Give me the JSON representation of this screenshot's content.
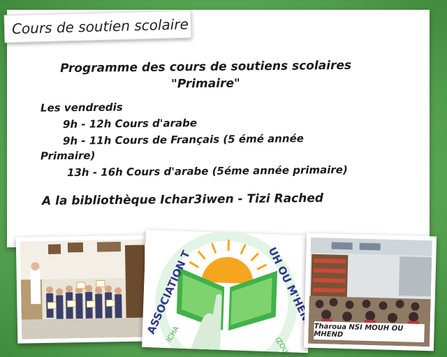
{
  "header": {
    "tag": "Cours de soutien scolaire"
  },
  "program": {
    "title_line1": "Programme des cours de soutiens scolaires",
    "title_line2": "\"Primaire\"",
    "schedule": [
      "Les vendredis",
      "9h - 12h  Cours d'arabe",
      "9h - 11h Cours de Français (5 émé année",
      "Primaire)",
      "13h - 16h  Cours d'arabe (5éme année primaire)"
    ],
    "location": "A la bibliothèque Ichar3iwen - Tizi Rached"
  },
  "logo": {
    "arc_left": "ASSOCIATION T",
    "arc_right": "UH OU M'HEND",
    "bottom_left": "ICHA",
    "bottom_right": "IZOU"
  },
  "photo_right_caption": "Tharoua NSI MOUH OU MHEND",
  "colors": {
    "background": "#6fbf6a",
    "logo_green": "#3fb24a",
    "sun": "#f5a623"
  }
}
